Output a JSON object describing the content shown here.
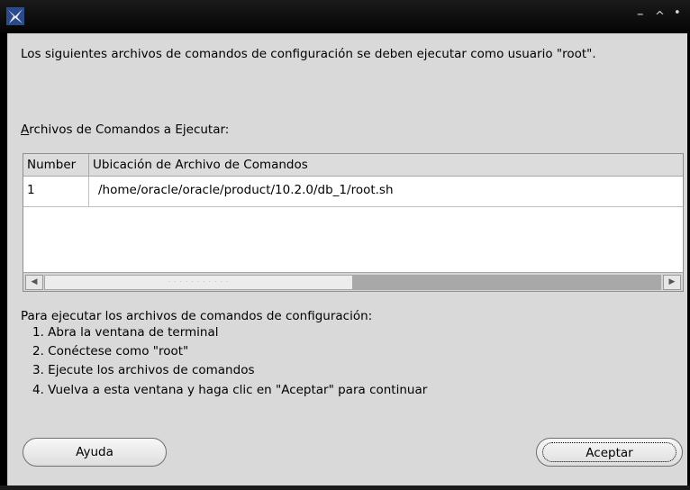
{
  "window": {
    "controls": {
      "minimize": "–",
      "maximize": "^",
      "close": "•"
    }
  },
  "intro_text": "Los siguientes archivos de comandos de configuración se deben ejecutar como usuario \"root\".",
  "section_label": {
    "mnemonic": "A",
    "rest": "rchivos de Comandos a Ejecutar:"
  },
  "table": {
    "columns": [
      "Number",
      "Ubicación de Archivo de Comandos"
    ],
    "rows": [
      [
        "1",
        "/home/oracle/oracle/product/10.2.0/db_1/root.sh"
      ]
    ],
    "scrollbar": {
      "left_arrow": "◀",
      "right_arrow": "▶",
      "thumb_grip": "· · · · · · · · · · ·"
    }
  },
  "instructions": {
    "heading": "Para ejecutar los archivos de comandos de configuración:",
    "steps": [
      "1. Abra la ventana de terminal",
      "2. Conéctese como \"root\"",
      "3. Ejecute los archivos de comandos",
      "4. Vuelva a esta ventana y haga clic en \"Aceptar\" para continuar"
    ]
  },
  "buttons": {
    "help": "Ayuda",
    "accept": "Aceptar"
  }
}
